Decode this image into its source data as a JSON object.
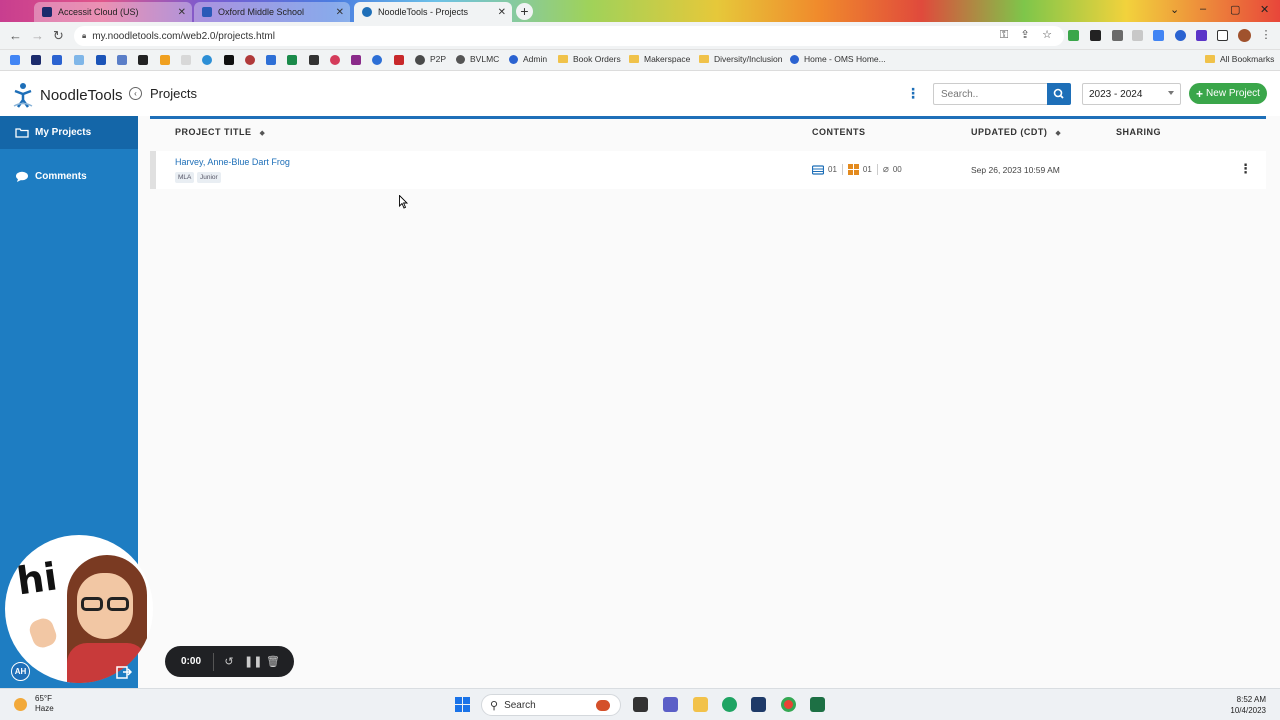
{
  "browser": {
    "tabs": [
      {
        "title": "Accessit Cloud (US)",
        "active": false
      },
      {
        "title": "Oxford Middle School",
        "active": false
      },
      {
        "title": "NoodleTools - Projects",
        "active": true
      }
    ],
    "url": "my.noodletools.com/web2.0/projects.html",
    "bookmarks": [
      "P2P",
      "BVLMC",
      "Admin",
      "Book Orders",
      "Makerspace",
      "Diversity/Inclusion",
      "Home - OMS Home..."
    ],
    "all_bookmarks_label": "All Bookmarks"
  },
  "app": {
    "logo_text": "NoodleTools",
    "page_title": "Projects",
    "search_placeholder": "Search..",
    "year_selected": "2023 - 2024",
    "new_project_label": "New Project"
  },
  "sidebar": {
    "items": [
      {
        "label": "My Projects",
        "active": true
      },
      {
        "label": "Comments",
        "active": false
      }
    ],
    "avatar_initials": "AH",
    "bitmoji_text": "hi"
  },
  "table": {
    "headers": {
      "title": "PROJECT TITLE",
      "contents": "CONTENTS",
      "updated": "UPDATED (CDT)",
      "sharing": "SHARING"
    },
    "rows": [
      {
        "title": "Harvey, Anne-Blue Dart Frog",
        "tags": [
          "MLA",
          "Junior"
        ],
        "sources": "01",
        "notecards": "01",
        "attachments": "00",
        "updated": "Sep 26, 2023 10:59 AM"
      }
    ]
  },
  "recorder": {
    "time": "0:00"
  },
  "taskbar": {
    "temp": "65°F",
    "condition": "Haze",
    "search_label": "Search",
    "time": "8:52 AM",
    "date": "10/4/2023"
  },
  "colors": {
    "brand_blue": "#1e6fb8",
    "sidebar_blue": "#1e7dc2",
    "green": "#3aa64a"
  }
}
